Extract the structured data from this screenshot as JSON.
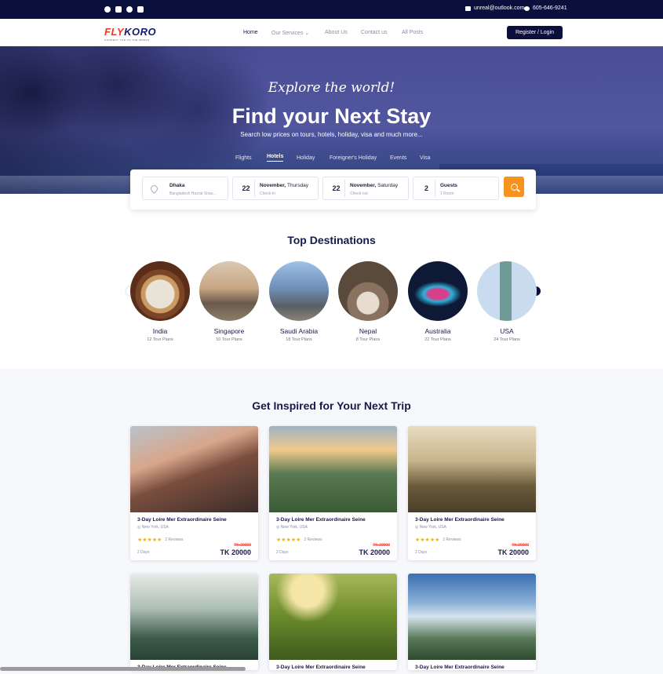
{
  "topbar": {
    "social_icons": [
      "dribbble-icon",
      "youtube-icon",
      "whatsapp-icon",
      "facebook-icon"
    ],
    "email": "unreal@outlook.com",
    "phone": "605-646-9241"
  },
  "nav": {
    "logo_text_a": "FLY",
    "logo_text_b": "KORO",
    "logo_tagline": "CONNECT YOU TO THE WORLD",
    "items": [
      "Home",
      "Our Services",
      "About Us",
      "Contact us",
      "All Posts"
    ],
    "register_label": "Register / Login"
  },
  "hero": {
    "script_text": "Explore the world!",
    "title": "Find your Next Stay",
    "subtitle": "Search low prices on tours, hotels, holiday, visa and much more...",
    "tabs": [
      "Flights",
      "Hotels",
      "Holiday",
      "Foreigner's Holiday",
      "Events",
      "Visa"
    ]
  },
  "search": {
    "location_city": "Dhaka",
    "location_detail": "Bangladesh Hazrat Shas...",
    "checkin_day": "22",
    "checkin_month": "November,",
    "checkin_weekday": "Thursday",
    "checkin_label": "Check-in",
    "checkout_day": "22",
    "checkout_month": "November,",
    "checkout_weekday": "Saturday",
    "checkout_label": "Check-out",
    "guests_count": "2",
    "guests_label": "Guests",
    "rooms_label": "1 Room"
  },
  "destinations": {
    "title": "Top Destinations",
    "items": [
      {
        "name": "India",
        "plans": "12 Tour Plans"
      },
      {
        "name": "Singapore",
        "plans": "10 Tour Plans"
      },
      {
        "name": "Saudi Arabia",
        "plans": "18 Tour Plans"
      },
      {
        "name": "Nepal",
        "plans": "8 Tour Plans"
      },
      {
        "name": "Australia",
        "plans": "22 Tour Plans"
      },
      {
        "name": "USA",
        "plans": "24 Tour Plans"
      }
    ]
  },
  "trips": {
    "title": "Get Inspired for Your Next Trip",
    "cards": [
      {
        "title": "3-Day Loire Mer Extraordinaire Seine",
        "location": "New York, USA",
        "stars": "★★★★★",
        "reviews": "2 Reviews",
        "days": "2 Days",
        "old_price": "TK 20000",
        "price": "TK 20000"
      },
      {
        "title": "3-Day Loire Mer Extraordinaire Seine",
        "location": "New York, USA",
        "stars": "★★★★★",
        "reviews": "2 Reviews",
        "days": "2 Days",
        "old_price": "TK 20000",
        "price": "TK 20000"
      },
      {
        "title": "3-Day Loire Mer Extraordinaire Seine",
        "location": "New York, USA",
        "stars": "★★★★★",
        "reviews": "2 Reviews",
        "days": "2 Days",
        "old_price": "TK 20000",
        "price": "TK 20000"
      },
      {
        "title": "3-Day Loire Mer Extraordinaire Seine"
      },
      {
        "title": "3-Day Loire Mer Extraordinaire Seine"
      },
      {
        "title": "3-Day Loire Mer Extraordinaire Seine"
      }
    ]
  },
  "colors": {
    "navy": "#0b0f3c",
    "accent": "#f7931e",
    "star": "#f4b400",
    "sale": "#e63a2e"
  }
}
